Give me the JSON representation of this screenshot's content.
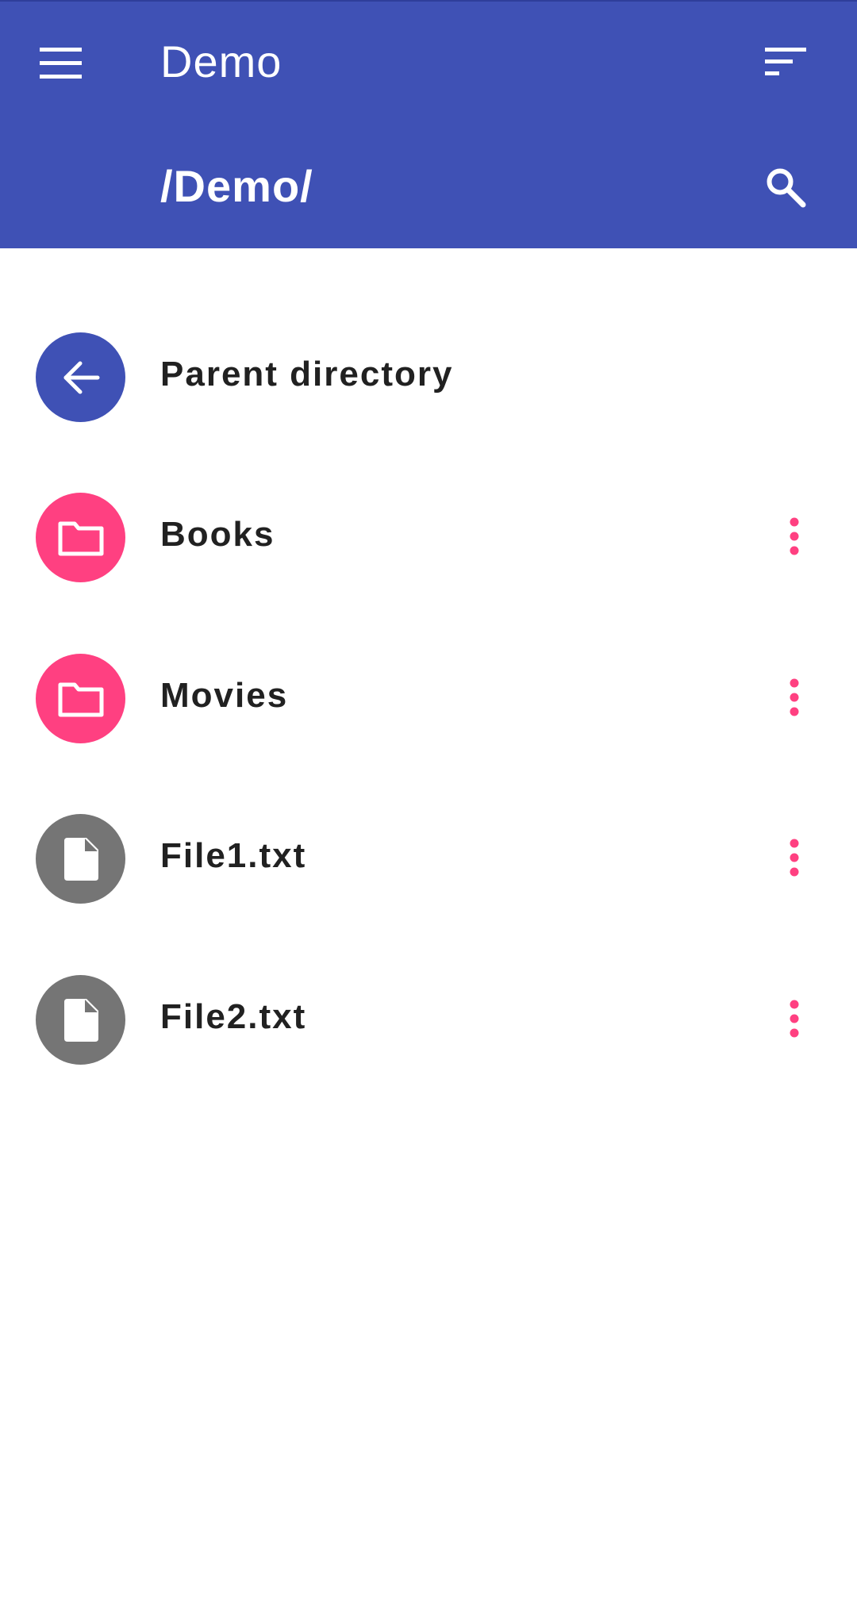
{
  "appbar": {
    "title": "Demo",
    "path": "/Demo/",
    "background_color": "#3f51b5",
    "menu_icon": "hamburger-menu-icon",
    "sort_icon": "sort-icon",
    "search_icon": "search-icon"
  },
  "list": {
    "items": [
      {
        "label": "Parent directory",
        "type": "parent",
        "icon": "arrow-back-icon",
        "color": "#3f51b5",
        "has_menu": false
      },
      {
        "label": "Books",
        "type": "folder",
        "icon": "folder-icon",
        "color": "#ff4081",
        "has_menu": true
      },
      {
        "label": "Movies",
        "type": "folder",
        "icon": "folder-icon",
        "color": "#ff4081",
        "has_menu": true
      },
      {
        "label": "File1.txt",
        "type": "file",
        "icon": "file-icon",
        "color": "#757575",
        "has_menu": true
      },
      {
        "label": "File2.txt",
        "type": "file",
        "icon": "file-icon",
        "color": "#757575",
        "has_menu": true
      }
    ],
    "more_icon": "more-vert-icon",
    "more_icon_color": "#ff4081"
  }
}
